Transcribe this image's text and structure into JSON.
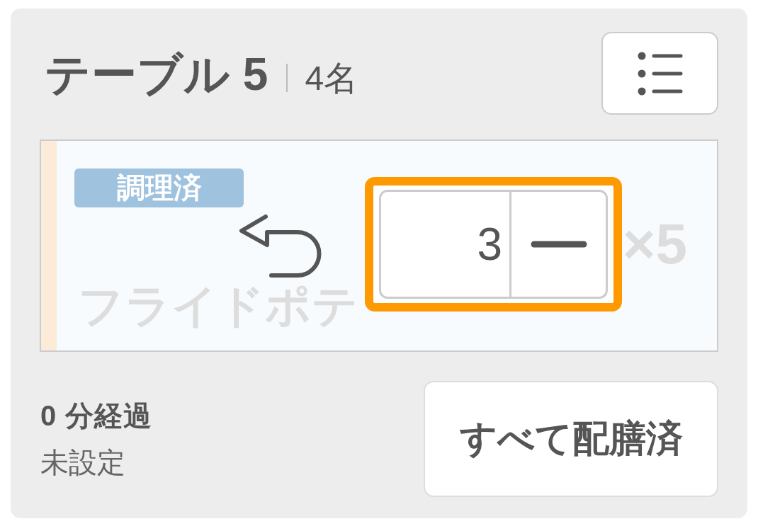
{
  "table": {
    "name": "テーブル 5",
    "guests": "4名"
  },
  "items": [
    {
      "status": "調理済",
      "name": "フライドポテ",
      "quantity": "×5",
      "dimmed": true,
      "stepper": {
        "value": "3",
        "focused": true
      }
    }
  ],
  "footer": {
    "elapsed": "0 分経過",
    "note": "未設定",
    "serve_all_button": "すべて配膳済"
  }
}
